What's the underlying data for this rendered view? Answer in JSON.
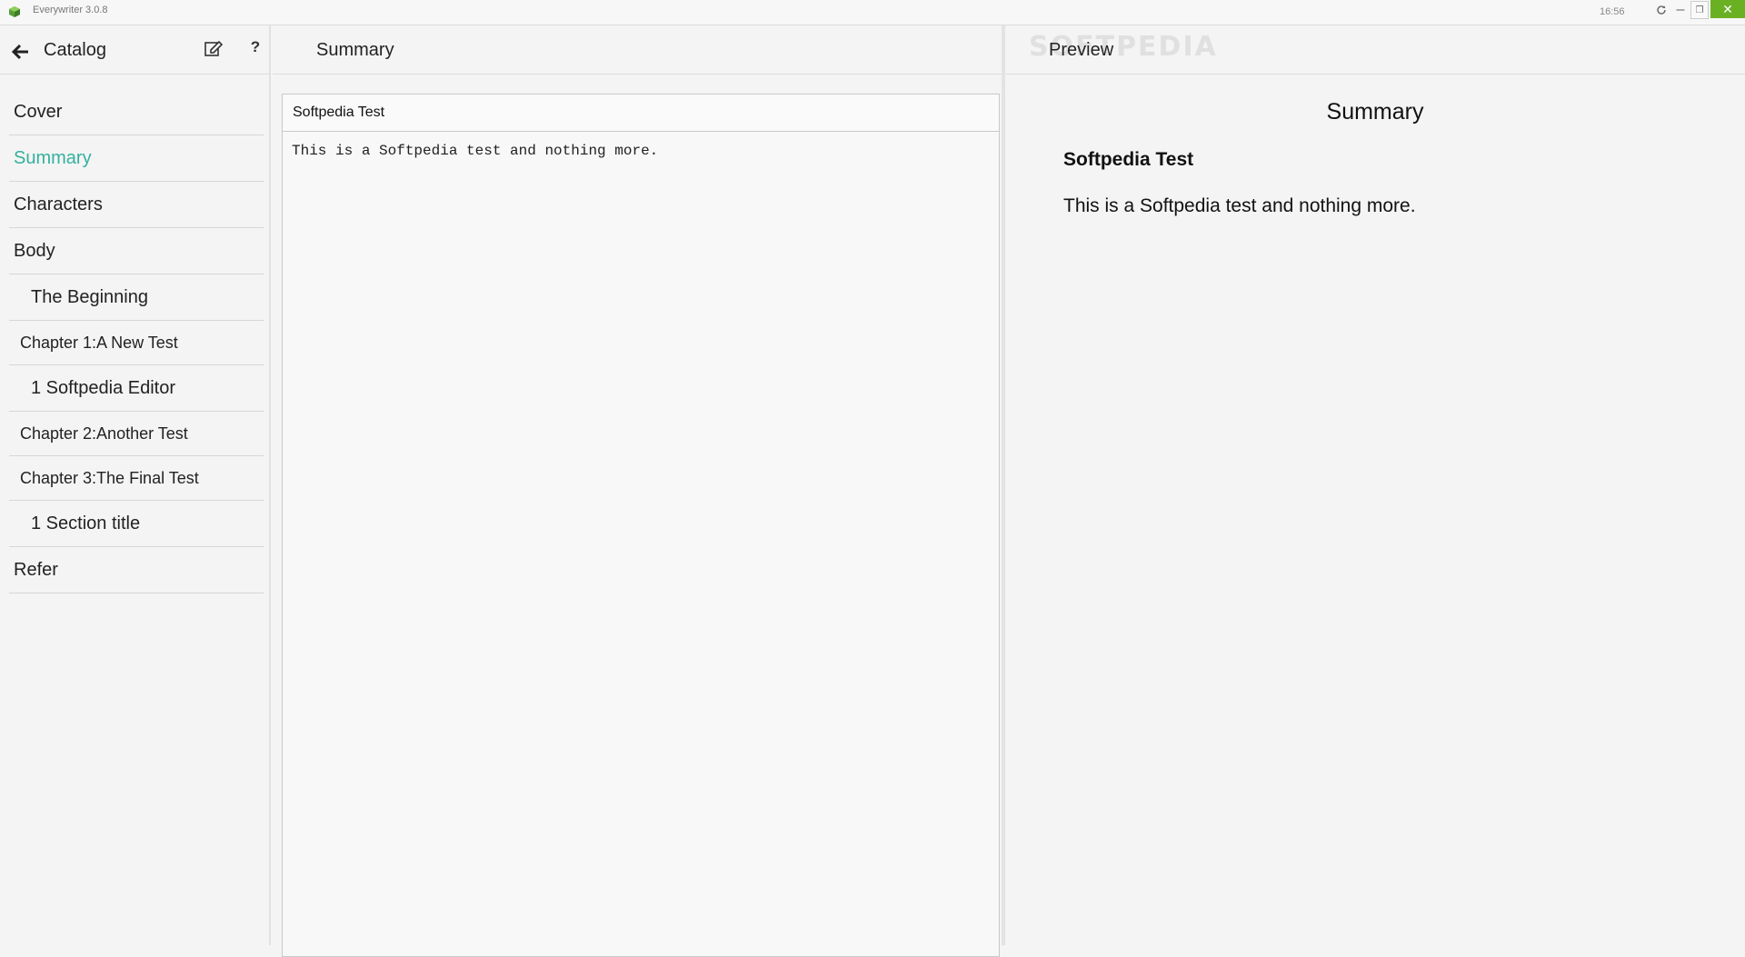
{
  "window": {
    "app_title": "Everywriter  3.0.8",
    "clock": "16:56",
    "accent_color": "#35b09e",
    "close_color": "#6ab023"
  },
  "sidebar": {
    "title": "Catalog",
    "items": [
      {
        "label": "Cover",
        "level": "top"
      },
      {
        "label": "Summary",
        "level": "top",
        "active": true
      },
      {
        "label": "Characters",
        "level": "top"
      },
      {
        "label": "Body",
        "level": "top"
      },
      {
        "label": "The Beginning",
        "level": "sub"
      },
      {
        "label": "Chapter 1:A New Test",
        "level": "chapter"
      },
      {
        "label": "1 Softpedia Editor",
        "level": "section"
      },
      {
        "label": "Chapter 2:Another Test",
        "level": "chapter"
      },
      {
        "label": "Chapter 3:The Final Test",
        "level": "chapter"
      },
      {
        "label": "1 Section title",
        "level": "section"
      },
      {
        "label": "Refer",
        "level": "top"
      }
    ]
  },
  "editor": {
    "header_title": "Summary",
    "title_value": "Softpedia Test",
    "body_value": "This is a Softpedia test and nothing more."
  },
  "preview": {
    "header_title": "Preview",
    "watermark": "SOFTPEDIA",
    "doc_title": "Summary",
    "heading": "Softpedia Test",
    "paragraph": "This is a Softpedia test and nothing more."
  }
}
